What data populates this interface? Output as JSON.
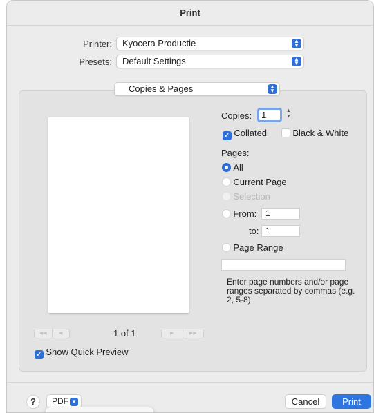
{
  "window": {
    "title": "Print"
  },
  "printer": {
    "label": "Printer:",
    "value": "Kyocera Productie"
  },
  "presets": {
    "label": "Presets:",
    "value": "Default Settings"
  },
  "section": {
    "value": "Copies & Pages"
  },
  "copies": {
    "label": "Copies:",
    "value": "1"
  },
  "collated": {
    "label": "Collated",
    "checked": true
  },
  "black_white": {
    "label": "Black & White",
    "checked": false
  },
  "pages": {
    "label": "Pages:",
    "all": "All",
    "current_page": "Current Page",
    "selection": "Selection",
    "from_label": "From:",
    "from_value": "1",
    "to_label": "to:",
    "to_value": "1",
    "page_range": "Page Range",
    "page_range_value": "",
    "selected": "All"
  },
  "hint": "Enter page numbers and/or page ranges separated by commas (e.g. 2, 5-8)",
  "preview": {
    "page_indicator": "1 of 1",
    "show_quick_preview": {
      "label": "Show Quick Preview",
      "checked": true
    }
  },
  "footer": {
    "help": "?",
    "pdf": "PDF",
    "cancel": "Cancel",
    "print": "Print"
  },
  "icons": {
    "popup_arrows": "chevron-up-down-icon",
    "first_page": "first-page-icon",
    "prev_page": "previous-page-icon",
    "next_page": "next-page-icon",
    "last_page": "last-page-icon",
    "copies_stepper": "stepper-icon",
    "pdf_dropdown": "chevron-down-icon"
  },
  "colors": {
    "accent": "#2f6fd6",
    "print_button": "#2f75e0"
  }
}
